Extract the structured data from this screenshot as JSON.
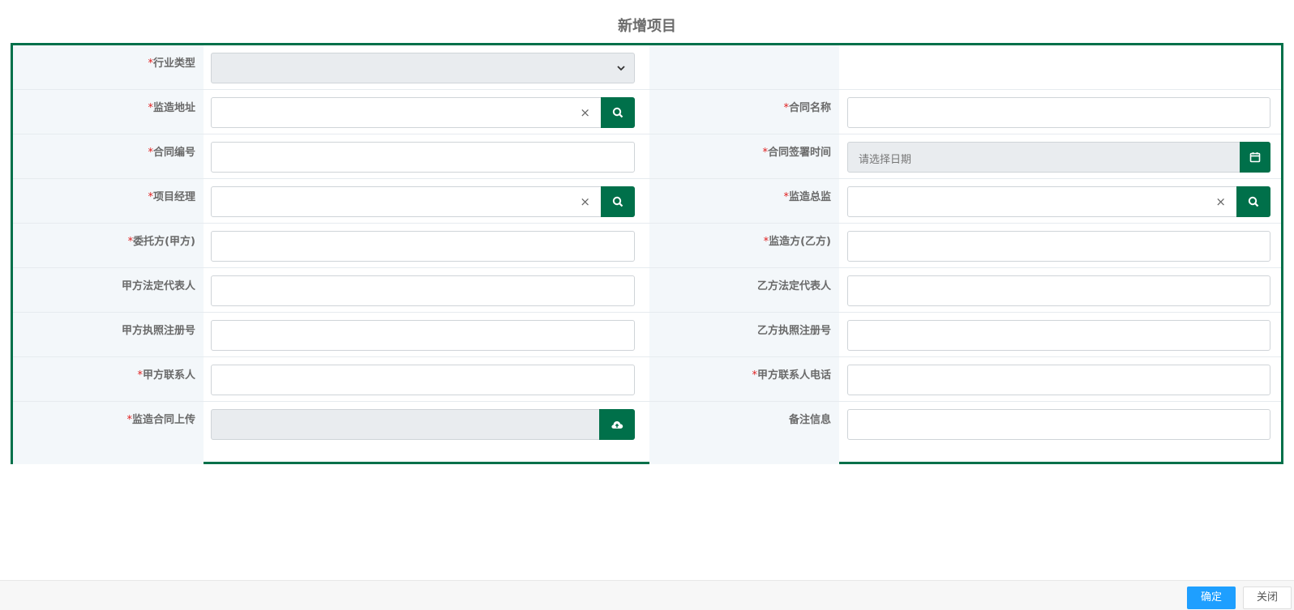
{
  "title": "新增项目",
  "colors": {
    "accent": "#00704a",
    "primary_button": "#1e9fff",
    "required": "#e02020"
  },
  "form": {
    "industry_type": {
      "label": "行业类型",
      "required": true,
      "value": ""
    },
    "address": {
      "label": "监造地址",
      "required": true,
      "value": "",
      "clear_icon": "×"
    },
    "contract_name": {
      "label": "合同名称",
      "required": true,
      "value": ""
    },
    "contract_no": {
      "label": "合同编号",
      "required": true,
      "value": ""
    },
    "sign_date": {
      "label": "合同签署时间",
      "required": true,
      "placeholder": "请选择日期"
    },
    "project_manager": {
      "label": "项目经理",
      "required": true,
      "value": "",
      "clear_icon": "×"
    },
    "director": {
      "label": "监造总监",
      "required": true,
      "value": "",
      "clear_icon": "×"
    },
    "party_a": {
      "label": "委托方(甲方)",
      "required": true,
      "value": ""
    },
    "party_b": {
      "label": "监造方(乙方)",
      "required": true,
      "value": ""
    },
    "a_legal_rep": {
      "label": "甲方法定代表人",
      "required": false,
      "value": ""
    },
    "b_legal_rep": {
      "label": "乙方法定代表人",
      "required": false,
      "value": ""
    },
    "a_license": {
      "label": "甲方执照注册号",
      "required": false,
      "value": ""
    },
    "b_license": {
      "label": "乙方执照注册号",
      "required": false,
      "value": ""
    },
    "a_contact": {
      "label": "甲方联系人",
      "required": true,
      "value": ""
    },
    "a_contact_phone": {
      "label": "甲方联系人电话",
      "required": true,
      "value": ""
    },
    "contract_upload": {
      "label": "监造合同上传",
      "required": true,
      "value": ""
    },
    "remarks": {
      "label": "备注信息",
      "required": false,
      "value": ""
    }
  },
  "required_mark": "*",
  "buttons": {
    "confirm": "确定",
    "close": "关闭"
  },
  "icons": {
    "search": "search-icon",
    "calendar": "calendar-icon",
    "upload": "cloud-upload-icon",
    "dropdown": "chevron-down-icon"
  }
}
